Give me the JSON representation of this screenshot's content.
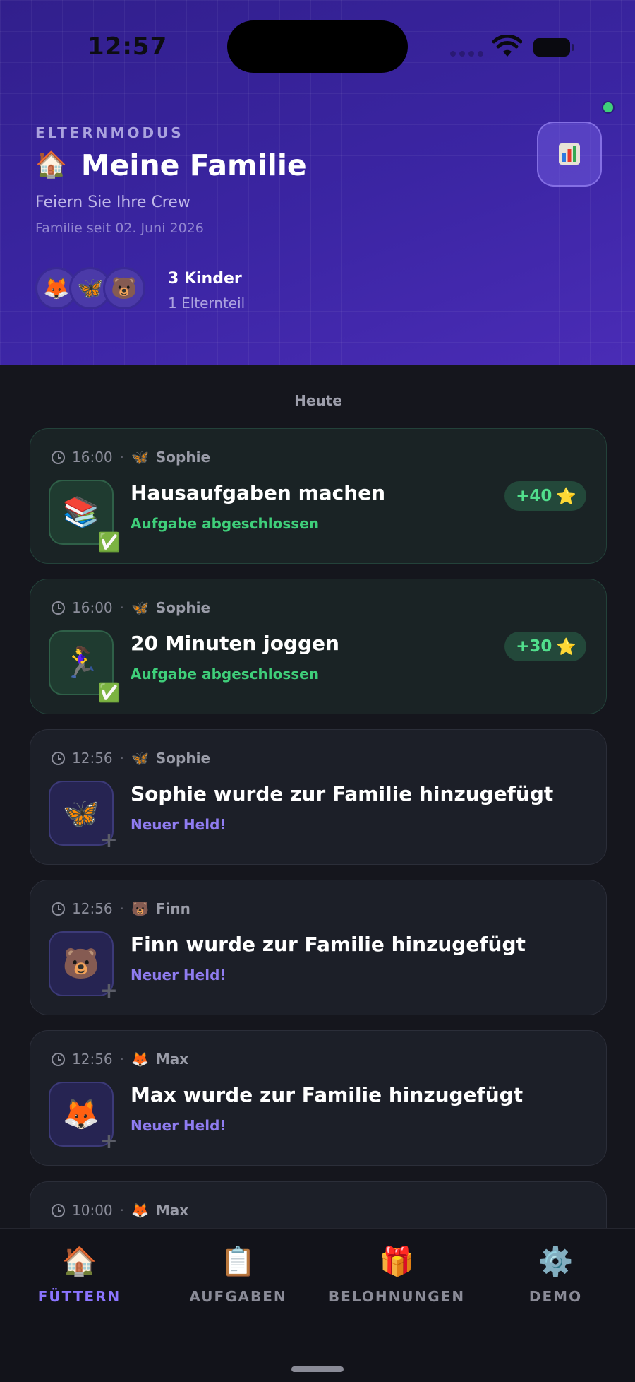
{
  "status_bar": {
    "time": "12:57"
  },
  "header": {
    "mode_label": "ELTERNMODUS",
    "home_emoji": "🏠",
    "title": "Meine Familie",
    "subtitle": "Feiern Sie Ihre Crew",
    "since": "Familie seit 02. Juni 2026",
    "stats_emoji": "📊",
    "avatars": [
      "🦊",
      "🦋",
      "🐻"
    ],
    "kids_count": "3 Kinder",
    "parents_count": "1 Elternteil"
  },
  "feed": {
    "section_label": "Heute",
    "cards": [
      {
        "time": "16:00",
        "emoji": "🦋",
        "name": "Sophie",
        "tile": "📚",
        "badge": "✅",
        "title": "Hausaufgaben machen",
        "sub": "Aufgabe abgeschlossen",
        "points": "+40",
        "star": "⭐"
      },
      {
        "time": "16:00",
        "emoji": "🦋",
        "name": "Sophie",
        "tile": "🏃‍♀️",
        "badge": "✅",
        "title": "20 Minuten joggen",
        "sub": "Aufgabe abgeschlossen",
        "points": "+30",
        "star": "⭐"
      },
      {
        "time": "12:56",
        "emoji": "🦋",
        "name": "Sophie",
        "tile": "🦋",
        "badge": "+",
        "title": "Sophie wurde zur Familie hinzugefügt",
        "sub": "Neuer Held!"
      },
      {
        "time": "12:56",
        "emoji": "🐻",
        "name": "Finn",
        "tile": "🐻",
        "badge": "+",
        "title": "Finn wurde zur Familie hinzugefügt",
        "sub": "Neuer Held!"
      },
      {
        "time": "12:56",
        "emoji": "🦊",
        "name": "Max",
        "tile": "🦊",
        "badge": "+",
        "title": "Max wurde zur Familie hinzugefügt",
        "sub": "Neuer Held!"
      },
      {
        "time": "10:00",
        "emoji": "🦊",
        "name": "Max"
      }
    ]
  },
  "tabs": [
    {
      "icon": "🏠",
      "label": "FÜTTERN"
    },
    {
      "icon": "📋",
      "label": "AUFGABEN"
    },
    {
      "icon": "🎁",
      "label": "BELOHNUNGEN"
    },
    {
      "icon": "⚙️",
      "label": "DEMO"
    }
  ],
  "colors": {
    "header_start": "#311f8c",
    "header_end": "#4a2cb6",
    "background": "#15161d",
    "done_green": "#3fcf7a",
    "new_purple": "#8f7cf0",
    "active_tab": "#8b74ff"
  }
}
